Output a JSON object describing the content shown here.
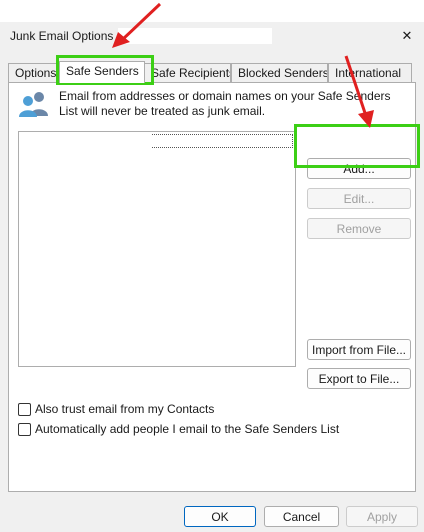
{
  "window": {
    "title": "Junk Email Options -",
    "close_glyph": "✕"
  },
  "tabs": [
    {
      "label": "Options",
      "active": false
    },
    {
      "label": "Safe Senders",
      "active": true
    },
    {
      "label": "Safe Recipients",
      "active": false
    },
    {
      "label": "Blocked Senders",
      "active": false
    },
    {
      "label": "International",
      "active": false
    }
  ],
  "panel": {
    "icon": "people-icon",
    "description": "Email from addresses or domain names on your Safe Senders List will never be treated as junk email.",
    "buttons": {
      "add": "Add...",
      "edit": "Edit...",
      "remove": "Remove",
      "import": "Import from File...",
      "export": "Export to File..."
    },
    "checkboxes": [
      {
        "label": "Also trust email from my Contacts",
        "checked": false
      },
      {
        "label": "Automatically add people I email to the Safe Senders List",
        "checked": false
      }
    ]
  },
  "footer": {
    "ok": "OK",
    "cancel": "Cancel",
    "apply": "Apply"
  },
  "annotations": {
    "highlight_color": "#3ccf15",
    "arrow_color": "#e02020"
  }
}
